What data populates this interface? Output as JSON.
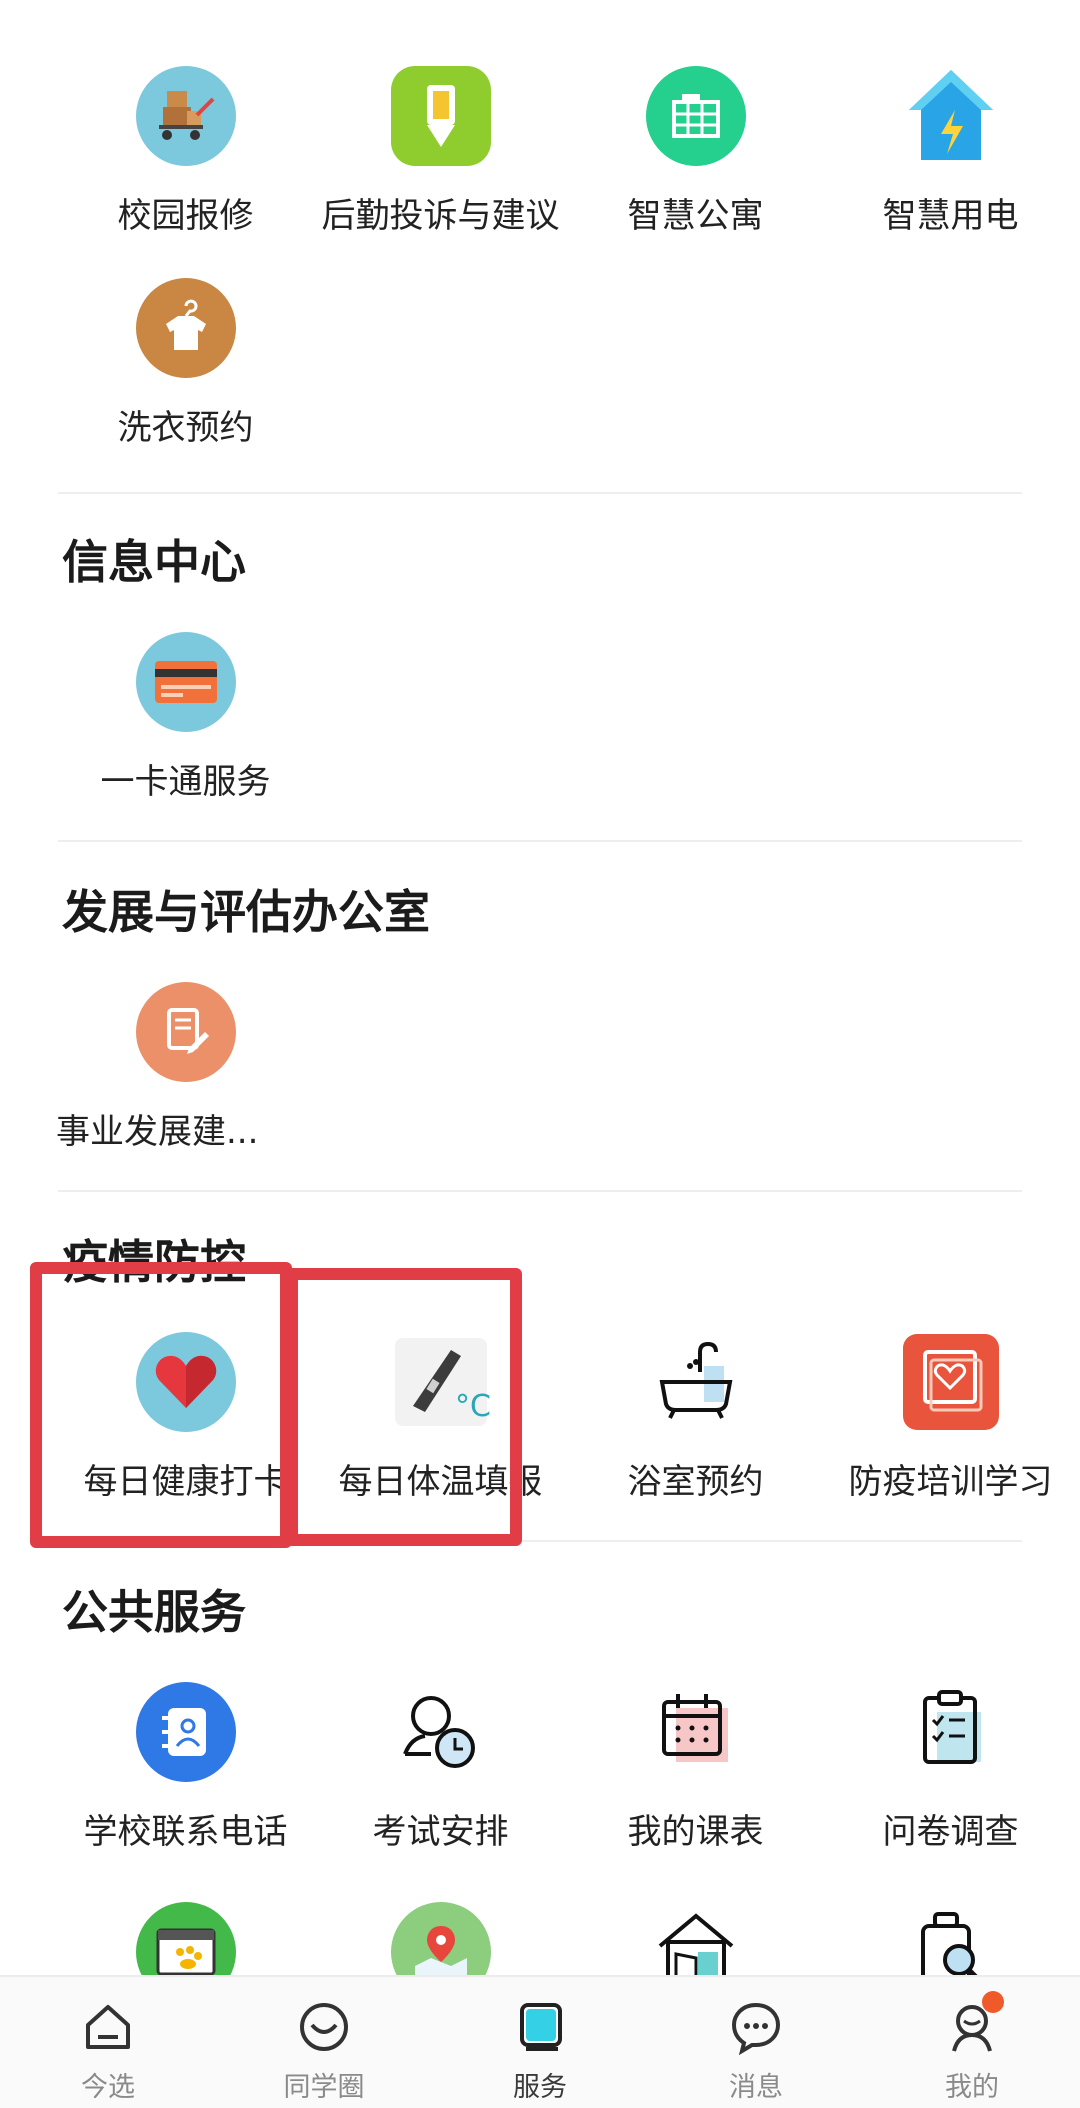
{
  "sections": [
    {
      "title": "",
      "items": [
        {
          "label": "校园报修",
          "icon": "repair-cart-icon"
        },
        {
          "label": "后勤投诉与建议",
          "icon": "pencil-icon"
        },
        {
          "label": "智慧公寓",
          "icon": "building-icon"
        },
        {
          "label": "智慧用电",
          "icon": "house-lightning-icon"
        },
        {
          "label": "洗衣预约",
          "icon": "shirt-hanger-icon"
        }
      ]
    },
    {
      "title": "信息中心",
      "items": [
        {
          "label": "一卡通服务",
          "icon": "card-icon"
        }
      ]
    },
    {
      "title": "发展与评估办公室",
      "items": [
        {
          "label": "事业发展建...",
          "icon": "document-edit-icon"
        }
      ]
    },
    {
      "title": "疫情防控",
      "items": [
        {
          "label": "每日健康打卡",
          "icon": "heart-icon"
        },
        {
          "label": "每日体温填报",
          "icon": "thermometer-icon"
        },
        {
          "label": "浴室预约",
          "icon": "bathtub-icon"
        },
        {
          "label": "防疫培训学习",
          "icon": "health-monitor-icon"
        }
      ]
    },
    {
      "title": "公共服务",
      "items": [
        {
          "label": "学校联系电话",
          "icon": "contacts-book-icon"
        },
        {
          "label": "考试安排",
          "icon": "exam-clock-icon"
        },
        {
          "label": "我的课表",
          "icon": "calendar-icon"
        },
        {
          "label": "问卷调查",
          "icon": "clipboard-check-icon"
        },
        {
          "label": "",
          "icon": "paw-window-icon"
        },
        {
          "label": "",
          "icon": "map-pin-icon"
        },
        {
          "label": "",
          "icon": "library-book-icon"
        },
        {
          "label": "",
          "icon": "luggage-search-icon"
        }
      ]
    }
  ],
  "tabs": [
    {
      "label": "今选",
      "icon": "home-icon"
    },
    {
      "label": "同学圈",
      "icon": "smile-circle-icon"
    },
    {
      "label": "服务",
      "icon": "service-square-icon",
      "active": true
    },
    {
      "label": "消息",
      "icon": "chat-bubble-icon"
    },
    {
      "label": "我的",
      "icon": "profile-icon",
      "badge": true
    }
  ],
  "colors": {
    "highlight": "#e13d47",
    "accent": "#34d1e6",
    "badge": "#f05a2a"
  }
}
